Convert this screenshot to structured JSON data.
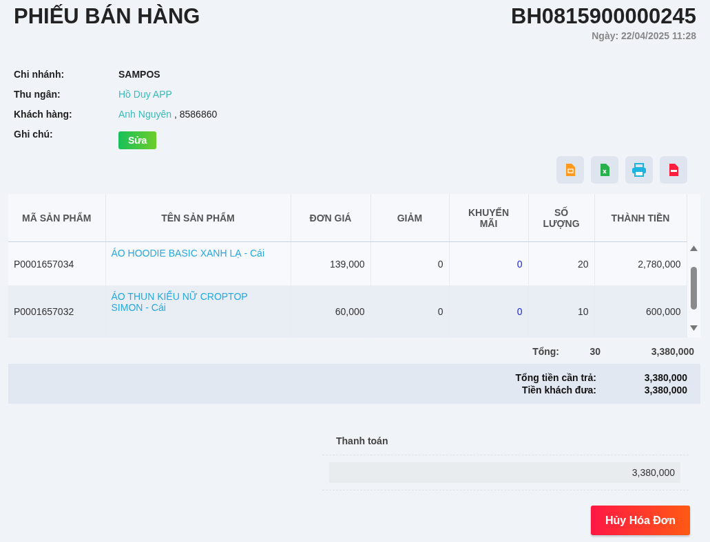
{
  "title": "PHIẾU BÁN HÀNG",
  "invoice_code": "BH0815900000245",
  "date": "Ngày: 22/04/2025 11:28",
  "info": [
    {
      "label": "Chi nhánh:",
      "kind": "bold",
      "value": "SAMPOS"
    },
    {
      "label": "Thu ngân:",
      "kind": "link",
      "value": "Hồ Duy APP"
    },
    {
      "label": "Khách hàng:",
      "kind": "link",
      "value": "Anh Nguyên",
      "extra": ", 8586860"
    },
    {
      "label": "Ghi chú:",
      "kind": "button",
      "value": "Sửa"
    }
  ],
  "toolbar": [
    {
      "kind": "doc"
    },
    {
      "kind": "excel"
    },
    {
      "kind": "print"
    },
    {
      "kind": "pdf"
    }
  ],
  "table": {
    "columns": [
      "MÃ SẢN PHẨM",
      "TÊN SẢN PHẨM",
      "ĐƠN GIÁ",
      "GIẢM",
      "KHUYẾN MÃI",
      "SỐ LƯỢNG",
      "THÀNH TIỀN"
    ],
    "rows": [
      [
        "P0001657034",
        "ÁO HOODIE BASIC XANH LẠ - Cái",
        "139,000",
        "0",
        "0",
        "20",
        "2,780,000"
      ],
      [
        "P0001657032",
        "ÁO THUN KIỂU NỮ CROPTOP SIMON - Cái",
        "60,000",
        "0",
        "0",
        "10",
        "600,000"
      ]
    ]
  },
  "total": {
    "label": "Tổng:",
    "quantity": "30",
    "amount": "3,380,000"
  },
  "summary": [
    {
      "label": "Tổng tiền cần trả:",
      "value": "3,380,000"
    },
    {
      "label": "Tiền khách đưa:",
      "value": "3,380,000"
    }
  ],
  "payment": {
    "title": "Thanh toán",
    "value": "3,380,000"
  },
  "cancel_button": "Hủy Hóa Đơn"
}
